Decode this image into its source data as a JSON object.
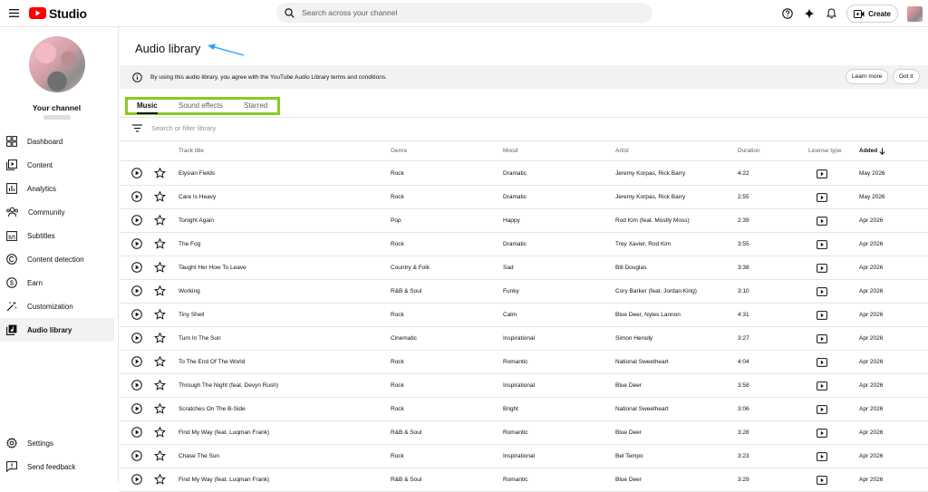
{
  "topbar": {
    "logo_text": "Studio",
    "search_placeholder": "Search across your channel",
    "create_label": "Create"
  },
  "sidebar": {
    "channel_label": "Your channel",
    "items": [
      {
        "label": "Dashboard",
        "icon": "dashboard-icon"
      },
      {
        "label": "Content",
        "icon": "content-icon"
      },
      {
        "label": "Analytics",
        "icon": "analytics-icon"
      },
      {
        "label": "Community",
        "icon": "community-icon"
      },
      {
        "label": "Subtitles",
        "icon": "subtitles-icon"
      },
      {
        "label": "Content detection",
        "icon": "copyright-icon"
      },
      {
        "label": "Earn",
        "icon": "earn-icon"
      },
      {
        "label": "Customization",
        "icon": "customization-icon"
      },
      {
        "label": "Audio library",
        "icon": "audio-library-icon"
      }
    ],
    "bottom": [
      {
        "label": "Settings",
        "icon": "gear-icon"
      },
      {
        "label": "Send feedback",
        "icon": "feedback-icon"
      }
    ]
  },
  "main": {
    "title": "Audio library",
    "banner_text": "By using this audio library, you agree with the YouTube Audio Library terms and conditions.",
    "learn_more": "Learn more",
    "got_it": "Got it",
    "tabs": [
      "Music",
      "Sound effects",
      "Starred"
    ],
    "filter_placeholder": "Search or filter library",
    "columns": {
      "track": "Track title",
      "genre": "Genre",
      "mood": "Mood",
      "artist": "Artist",
      "duration": "Duration",
      "license": "License type",
      "added": "Added"
    },
    "rows": [
      {
        "title": "Elysian Fields",
        "genre": "Rock",
        "mood": "Dramatic",
        "artist": "Jeremy Korpas, Rick Barry",
        "duration": "4:22",
        "added": "May 2026"
      },
      {
        "title": "Care Is Heavy",
        "genre": "Rock",
        "mood": "Dramatic",
        "artist": "Jeremy Korpas, Rick Barry",
        "duration": "2:55",
        "added": "May 2026"
      },
      {
        "title": "Tonight Again",
        "genre": "Pop",
        "mood": "Happy",
        "artist": "Rod Kim (feat. Mostly Moss)",
        "duration": "2:39",
        "added": "Apr 2026"
      },
      {
        "title": "The Fog",
        "genre": "Rock",
        "mood": "Dramatic",
        "artist": "Trey Xavier, Rod Kim",
        "duration": "3:55",
        "added": "Apr 2026"
      },
      {
        "title": "Taught Her How To Leave",
        "genre": "Country & Folk",
        "mood": "Sad",
        "artist": "Bill Douglas",
        "duration": "3:38",
        "added": "Apr 2026"
      },
      {
        "title": "Working",
        "genre": "R&B & Soul",
        "mood": "Funky",
        "artist": "Cory Barker (feat. Jordan King)",
        "duration": "3:10",
        "added": "Apr 2026"
      },
      {
        "title": "Tiny Shell",
        "genre": "Rock",
        "mood": "Calm",
        "artist": "Blue Deer, Nyles Lannon",
        "duration": "4:31",
        "added": "Apr 2026"
      },
      {
        "title": "Turn In The Sun",
        "genre": "Cinematic",
        "mood": "Inspirational",
        "artist": "Simon Herody",
        "duration": "3:27",
        "added": "Apr 2026"
      },
      {
        "title": "To The End Of The World",
        "genre": "Rock",
        "mood": "Romantic",
        "artist": "National Sweetheart",
        "duration": "4:04",
        "added": "Apr 2026"
      },
      {
        "title": "Through The Night (feat. Devyn Rush)",
        "genre": "Rock",
        "mood": "Inspirational",
        "artist": "Blue Deer",
        "duration": "3:58",
        "added": "Apr 2026"
      },
      {
        "title": "Scratches On The B-Side",
        "genre": "Rock",
        "mood": "Bright",
        "artist": "National Sweetheart",
        "duration": "3:06",
        "added": "Apr 2026"
      },
      {
        "title": "Find My Way (feat. Luqman Frank)",
        "genre": "R&B & Soul",
        "mood": "Romantic",
        "artist": "Blue Deer",
        "duration": "3:28",
        "added": "Apr 2026"
      },
      {
        "title": "Chase The Sun",
        "genre": "Rock",
        "mood": "Inspirational",
        "artist": "Bel Tempo",
        "duration": "3:23",
        "added": "Apr 2026"
      },
      {
        "title": "Find My Way (feat. Luqman Frank)",
        "genre": "R&B & Soul",
        "mood": "Romantic",
        "artist": "Blue Deer",
        "duration": "3:29",
        "added": "Apr 2026"
      }
    ]
  },
  "colors": {
    "brand_red": "#ff0000",
    "tab_highlight": "#86cc21",
    "arrow": "#2aa3f0"
  }
}
